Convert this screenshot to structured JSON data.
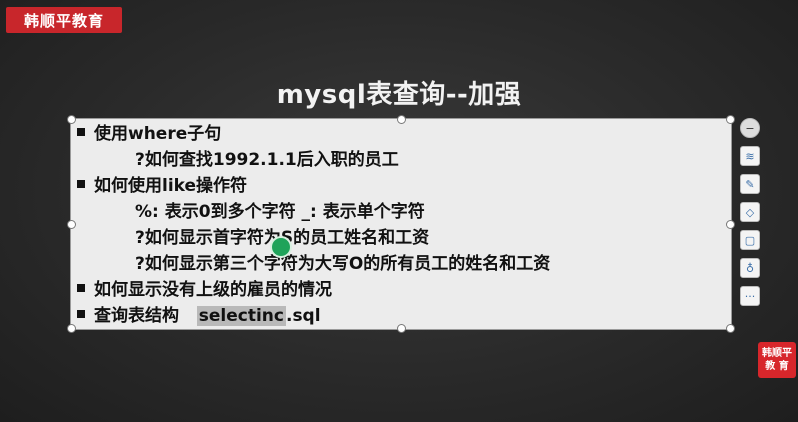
{
  "brand": {
    "top_left": "韩顺平教育",
    "bottom_right_line1": "韩顺平",
    "bottom_right_line2": "教 育"
  },
  "slide": {
    "title": "mysql表查询--加强",
    "items": [
      {
        "level": 1,
        "text": "使用where子句"
      },
      {
        "level": 2,
        "text": "?如何查找1992.1.1后入职的员工"
      },
      {
        "level": 1,
        "text": "如何使用like操作符"
      },
      {
        "level": 2,
        "text": "%: 表示0到多个字符 _: 表示单个字符"
      },
      {
        "level": 2,
        "text": "?如何显示首字符为S的员工姓名和工资"
      },
      {
        "level": 2,
        "text": "?如何显示第三个字符为大写O的所有员工的姓名和工资"
      },
      {
        "level": 1,
        "text": "如何显示没有上级的雇员的情况"
      },
      {
        "level": 1,
        "text": "查询表结构",
        "highlight": "selectinc",
        "suffix": ".sql"
      }
    ]
  },
  "toolbar": {
    "buttons": [
      {
        "name": "minus-icon",
        "glyph": "−"
      },
      {
        "name": "layers-icon",
        "glyph": "≋"
      },
      {
        "name": "pen-icon",
        "glyph": "✎"
      },
      {
        "name": "eraser-icon",
        "glyph": "◇"
      },
      {
        "name": "frame-icon",
        "glyph": "▢"
      },
      {
        "name": "bulb-icon",
        "glyph": "♁"
      },
      {
        "name": "more-icon",
        "glyph": "···"
      }
    ]
  }
}
